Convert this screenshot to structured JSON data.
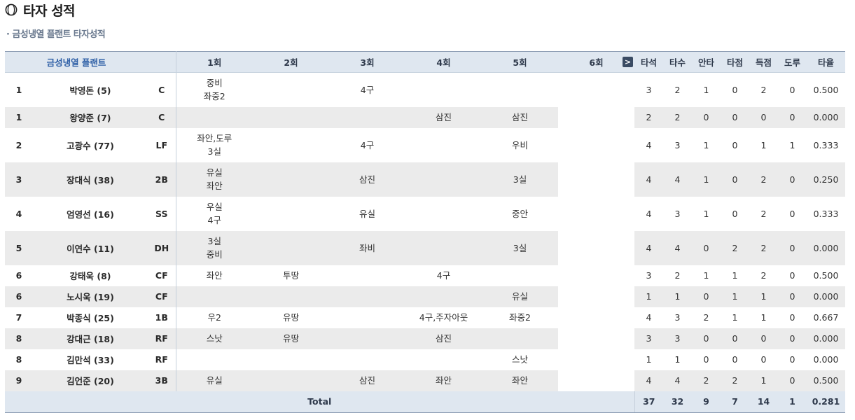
{
  "page": {
    "title": "타자 성적",
    "subtitle": "금성냉열 플랜트 타자성적"
  },
  "header": {
    "team": "금성냉열 플랜트",
    "innings": [
      "1회",
      "2회",
      "3회",
      "4회",
      "5회",
      "6회"
    ],
    "next_label": ">",
    "stats": [
      "타석",
      "타수",
      "안타",
      "타점",
      "득점",
      "도루",
      "타율"
    ]
  },
  "rows": [
    {
      "order": "1",
      "name": "박영돈 (5)",
      "pos": "C",
      "innings": [
        "중비\n좌중2",
        "",
        "4구",
        "",
        "",
        ""
      ],
      "stats": [
        "3",
        "2",
        "1",
        "0",
        "2",
        "0",
        "0.500"
      ]
    },
    {
      "order": "1",
      "name": "왕양준 (7)",
      "pos": "C",
      "innings": [
        "",
        "",
        "",
        "삼진",
        "삼진",
        ""
      ],
      "stats": [
        "2",
        "2",
        "0",
        "0",
        "0",
        "0",
        "0.000"
      ]
    },
    {
      "order": "2",
      "name": "고광수 (77)",
      "pos": "LF",
      "innings": [
        "좌안,도루\n3실",
        "",
        "4구",
        "",
        "우비",
        ""
      ],
      "stats": [
        "4",
        "3",
        "1",
        "0",
        "1",
        "1",
        "0.333"
      ]
    },
    {
      "order": "3",
      "name": "장대식 (38)",
      "pos": "2B",
      "innings": [
        "유실\n좌안",
        "",
        "삼진",
        "",
        "3실",
        ""
      ],
      "stats": [
        "4",
        "4",
        "1",
        "0",
        "2",
        "0",
        "0.250"
      ]
    },
    {
      "order": "4",
      "name": "엄영선 (16)",
      "pos": "SS",
      "innings": [
        "우실\n4구",
        "",
        "유실",
        "",
        "중안",
        ""
      ],
      "stats": [
        "4",
        "3",
        "1",
        "0",
        "2",
        "0",
        "0.333"
      ]
    },
    {
      "order": "5",
      "name": "이연수 (11)",
      "pos": "DH",
      "innings": [
        "3실\n중비",
        "",
        "좌비",
        "",
        "3실",
        ""
      ],
      "stats": [
        "4",
        "4",
        "0",
        "2",
        "2",
        "0",
        "0.000"
      ]
    },
    {
      "order": "6",
      "name": "강태욱 (8)",
      "pos": "CF",
      "innings": [
        "좌안",
        "투땅",
        "",
        "4구",
        "",
        ""
      ],
      "stats": [
        "3",
        "2",
        "1",
        "1",
        "2",
        "0",
        "0.500"
      ]
    },
    {
      "order": "6",
      "name": "노시욱 (19)",
      "pos": "CF",
      "innings": [
        "",
        "",
        "",
        "",
        "유실",
        ""
      ],
      "stats": [
        "1",
        "1",
        "0",
        "1",
        "1",
        "0",
        "0.000"
      ]
    },
    {
      "order": "7",
      "name": "박종식 (25)",
      "pos": "1B",
      "innings": [
        "우2",
        "유땅",
        "",
        "4구,주자아웃",
        "좌중2",
        ""
      ],
      "stats": [
        "4",
        "3",
        "2",
        "1",
        "1",
        "0",
        "0.667"
      ]
    },
    {
      "order": "8",
      "name": "강대근 (18)",
      "pos": "RF",
      "innings": [
        "스낫",
        "유땅",
        "",
        "삼진",
        "",
        ""
      ],
      "stats": [
        "3",
        "3",
        "0",
        "0",
        "0",
        "0",
        "0.000"
      ]
    },
    {
      "order": "8",
      "name": "김만석 (33)",
      "pos": "RF",
      "innings": [
        "",
        "",
        "",
        "",
        "스낫",
        ""
      ],
      "stats": [
        "1",
        "1",
        "0",
        "0",
        "0",
        "0",
        "0.000"
      ]
    },
    {
      "order": "9",
      "name": "김언준 (20)",
      "pos": "3B",
      "innings": [
        "유실",
        "",
        "삼진",
        "좌안",
        "좌안",
        ""
      ],
      "stats": [
        "4",
        "4",
        "2",
        "2",
        "1",
        "0",
        "0.500"
      ]
    }
  ],
  "total": {
    "label": "Total",
    "stats": [
      "37",
      "32",
      "9",
      "7",
      "14",
      "1",
      "0.281"
    ]
  }
}
